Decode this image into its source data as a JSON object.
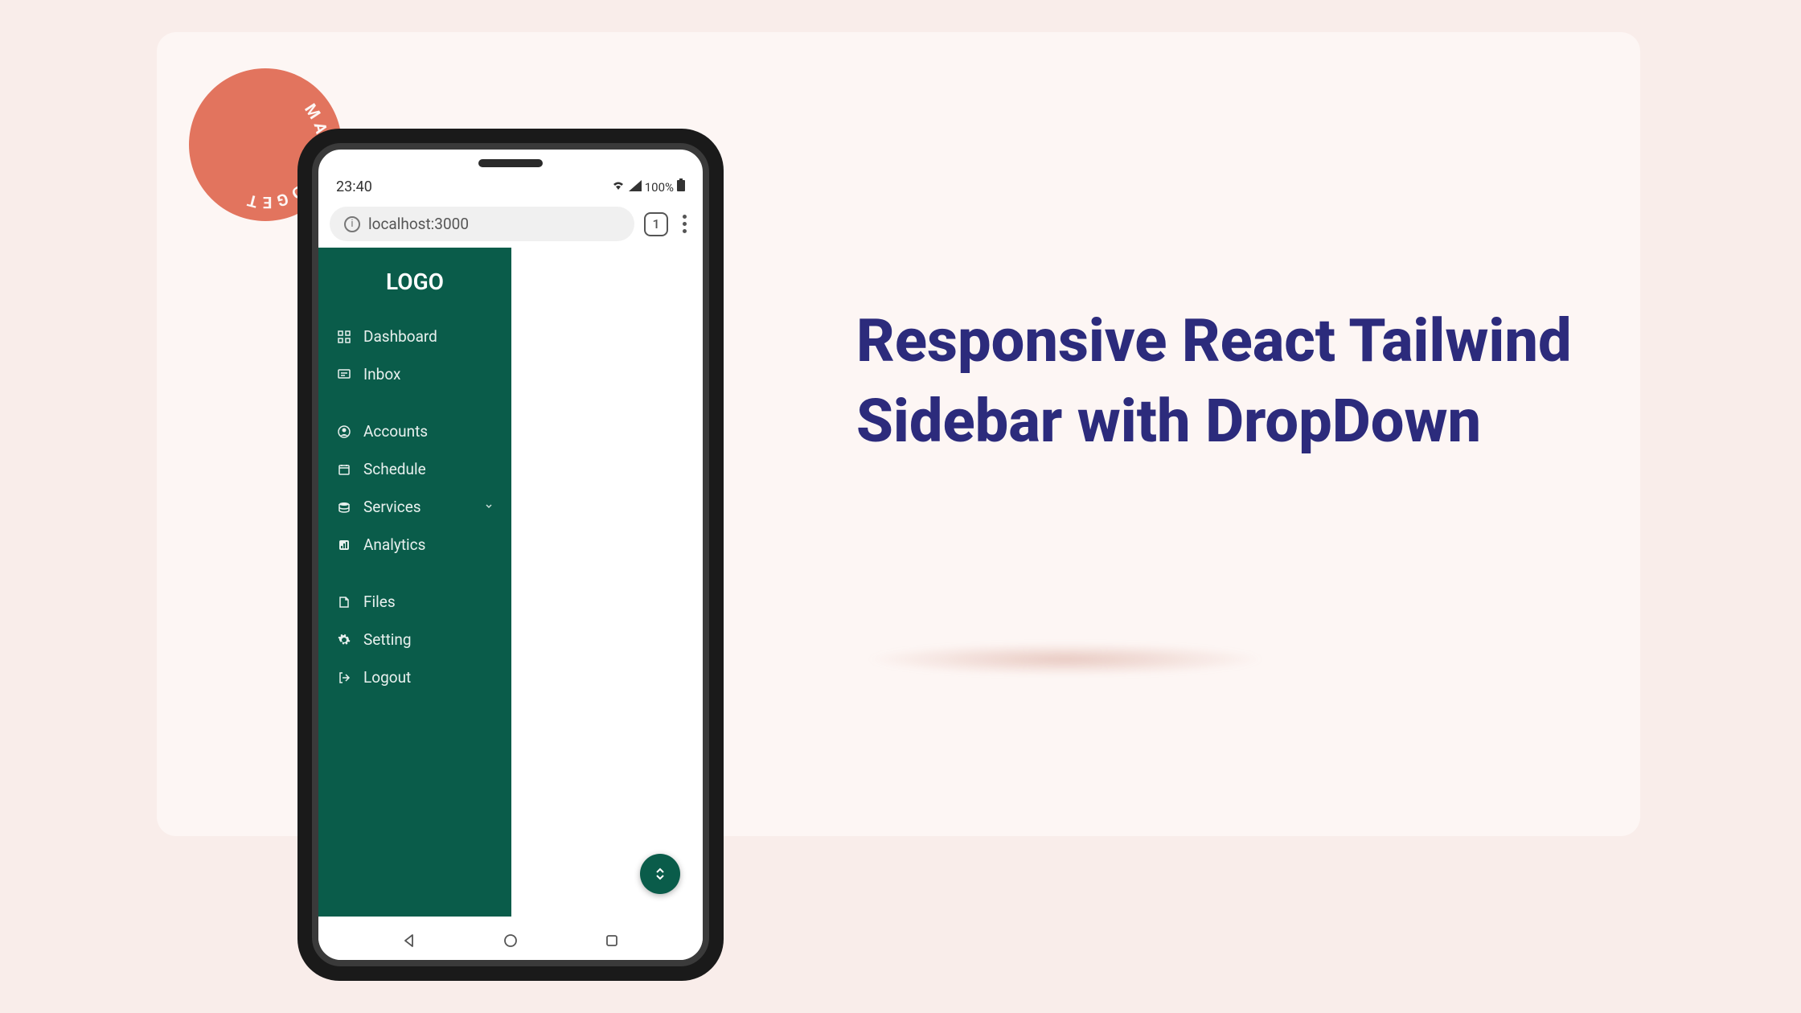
{
  "badge_text": "MAX GADGET",
  "heading": "Responsive React Tailwind Sidebar with DropDown",
  "status": {
    "time": "23:40",
    "battery": "100%"
  },
  "browser": {
    "url": "localhost:3000",
    "tab_count": "1"
  },
  "sidebar": {
    "logo": "LOGO",
    "groups": [
      [
        {
          "icon": "dashboard",
          "label": "Dashboard"
        },
        {
          "icon": "inbox",
          "label": "Inbox"
        }
      ],
      [
        {
          "icon": "account",
          "label": "Accounts"
        },
        {
          "icon": "schedule",
          "label": "Schedule"
        },
        {
          "icon": "services",
          "label": "Services",
          "dropdown": true
        },
        {
          "icon": "analytics",
          "label": "Analytics"
        }
      ],
      [
        {
          "icon": "files",
          "label": "Files"
        },
        {
          "icon": "setting",
          "label": "Setting"
        },
        {
          "icon": "logout",
          "label": "Logout"
        }
      ]
    ]
  }
}
